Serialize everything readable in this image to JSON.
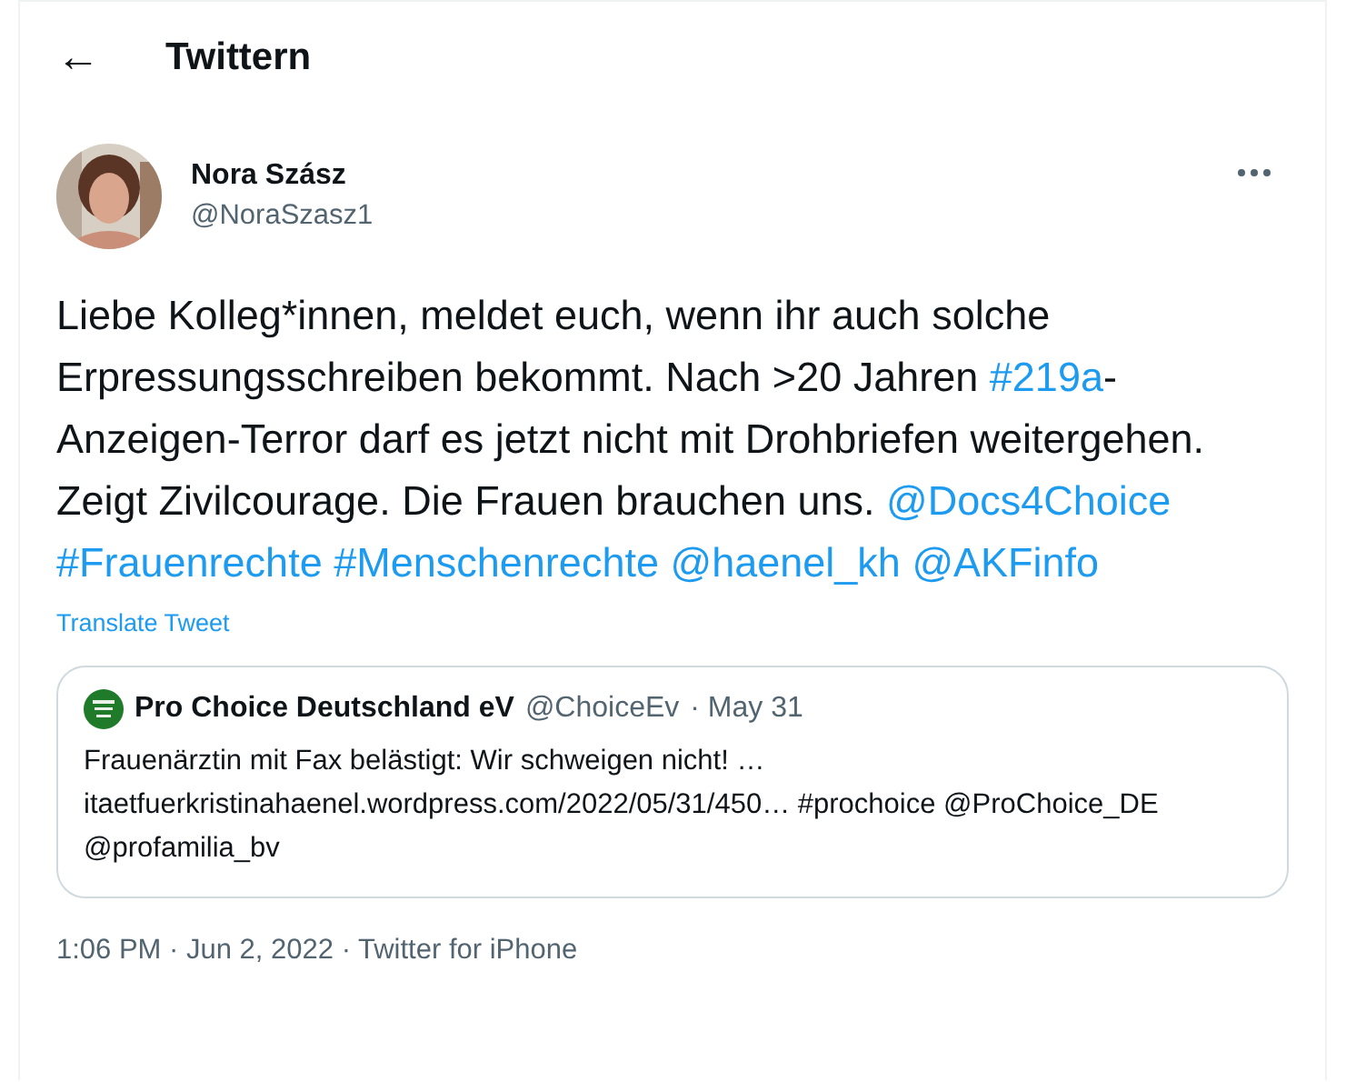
{
  "header": {
    "back_icon": "←",
    "title": "Twittern"
  },
  "tweet": {
    "author": {
      "name": "Nora Szász",
      "handle": "@NoraSzasz1"
    },
    "body": [
      {
        "kind": "text",
        "text": "Liebe Kolleg*innen, meldet euch, wenn ihr auch solche Erpressungsschreiben bekommt. Nach >20 Jahren "
      },
      {
        "kind": "link",
        "text": "#219a"
      },
      {
        "kind": "text",
        "text": "-Anzeigen-Terror darf es jetzt nicht mit Drohbriefen weitergehen. Zeigt Zivilcourage. Die Frauen brauchen uns. "
      },
      {
        "kind": "link",
        "text": "@Docs4Choice"
      },
      {
        "kind": "link",
        "text": "#Frauenrechte"
      },
      {
        "kind": "link",
        "text": "#Menschenrechte"
      },
      {
        "kind": "link",
        "text": "@haenel_kh"
      },
      {
        "kind": "link",
        "text": "@AKFinfo"
      }
    ],
    "translate": "Translate Tweet",
    "quote": {
      "name": "Pro Choice Deutschland eV",
      "handle": "@ChoiceEv",
      "date": "· May 31",
      "text": "Frauenärztin mit Fax belästigt: Wir schweigen nicht! … itaetfuerkristinahaenel.wordpress.com/2022/05/31/450… #prochoice @ProChoice_DE @profamilia_bv"
    },
    "meta": "1:06 PM · Jun 2, 2022 · Twitter for iPhone"
  }
}
